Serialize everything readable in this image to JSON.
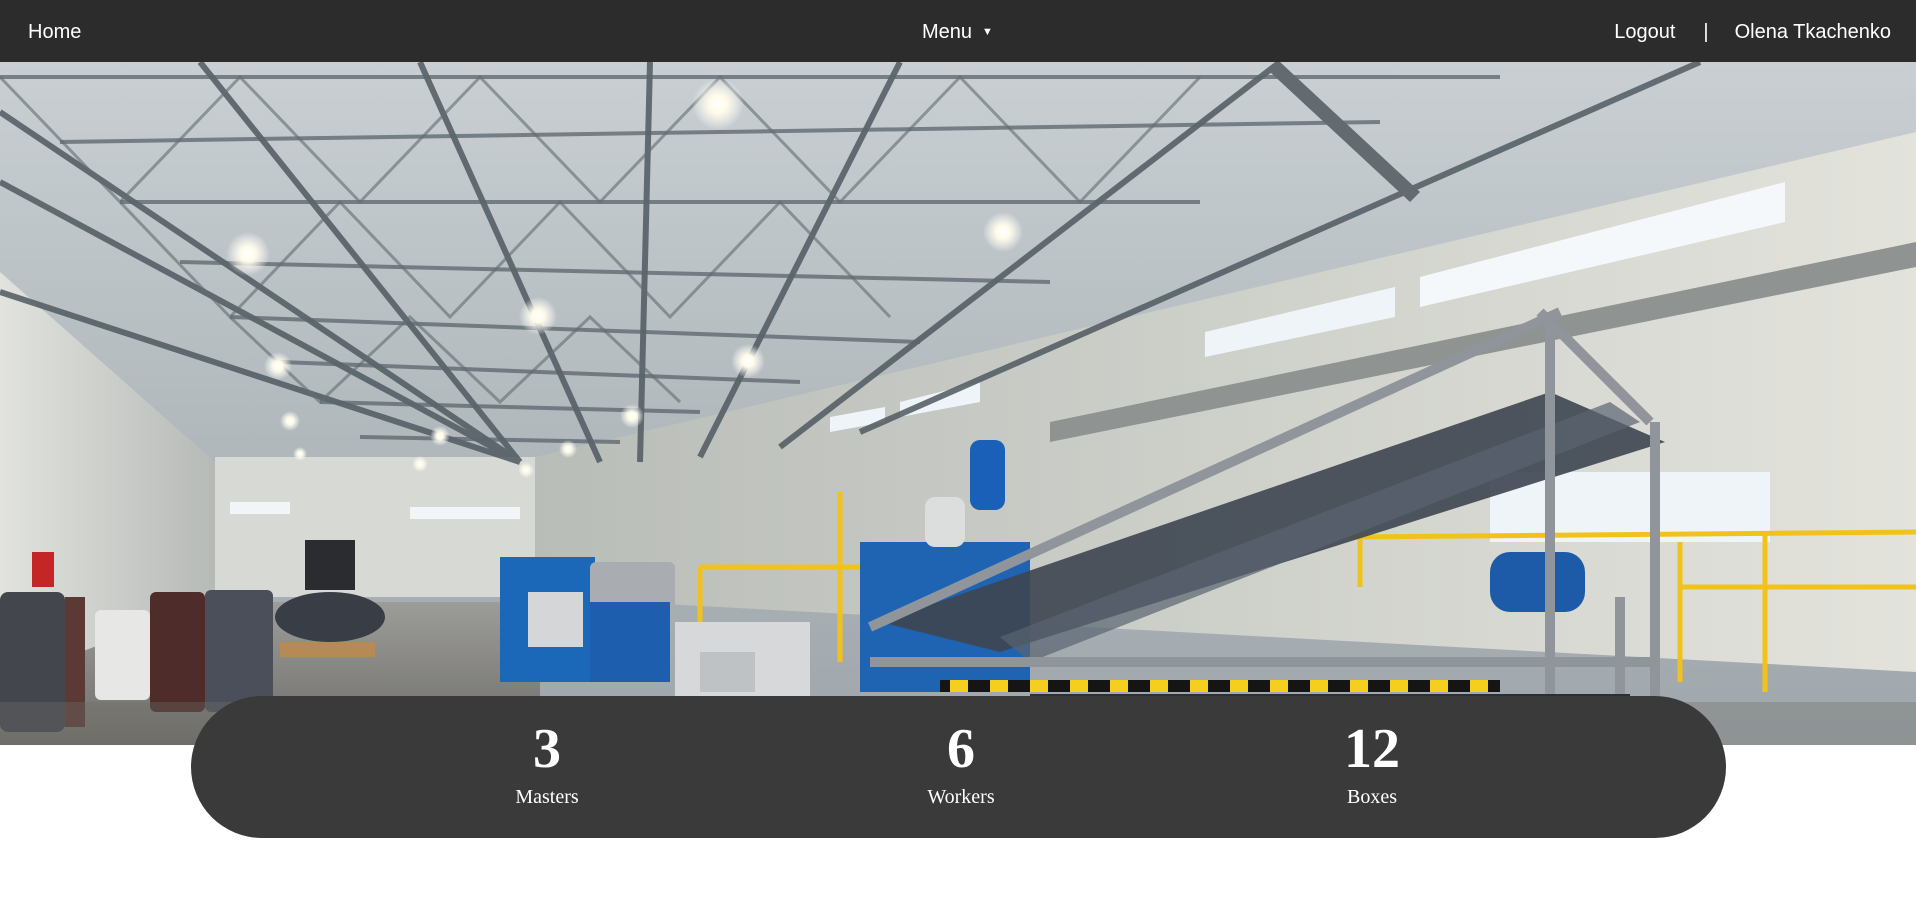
{
  "navbar": {
    "home_label": "Home",
    "menu_label": "Menu",
    "menu_caret": "▼",
    "logout_label": "Logout",
    "separator": "|",
    "user_name": "Olena Tkachenko",
    "background_color": "#2c2c2c"
  },
  "hero": {
    "image_subject": "industrial factory hall with steel roof trusses and a blue production line"
  },
  "stats": {
    "background_color": "#3a3a3a",
    "items": [
      {
        "value": "3",
        "label": "Masters"
      },
      {
        "value": "6",
        "label": "Workers"
      },
      {
        "value": "12",
        "label": "Boxes"
      }
    ]
  }
}
